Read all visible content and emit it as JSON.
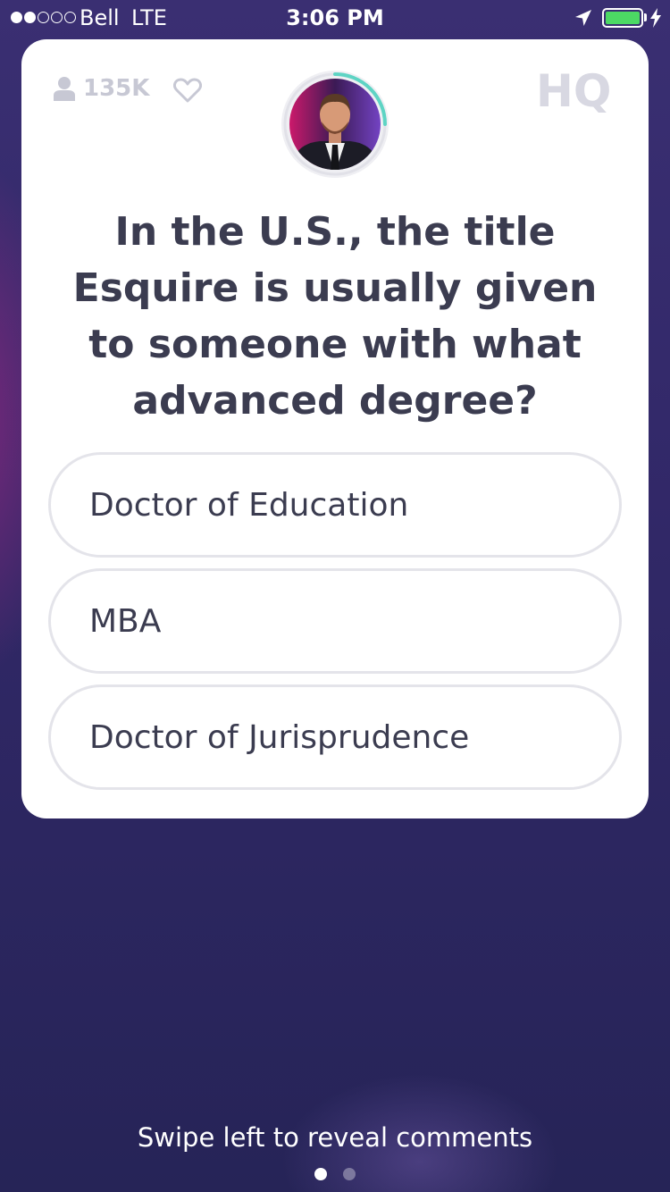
{
  "status_bar": {
    "carrier": "Bell",
    "network": "LTE",
    "time": "3:06 PM",
    "signal_bars_filled": 2,
    "signal_bars_total": 5,
    "battery_level": 1.0,
    "battery_color": "#4cd964"
  },
  "card": {
    "viewer_icon": "user-icon",
    "viewer_count": "135K",
    "like_icon": "heart-icon",
    "logo": "HQ",
    "timer_color": "#5ed4c4",
    "question": "In the U.S., the title Esquire is usually given to someone with what advanced degree?",
    "answers": [
      {
        "label": "Doctor of Education"
      },
      {
        "label": "MBA"
      },
      {
        "label": "Doctor of Jurisprudence"
      }
    ]
  },
  "footer": {
    "hint": "Swipe left to reveal comments",
    "pages_total": 2,
    "page_active": 1
  }
}
